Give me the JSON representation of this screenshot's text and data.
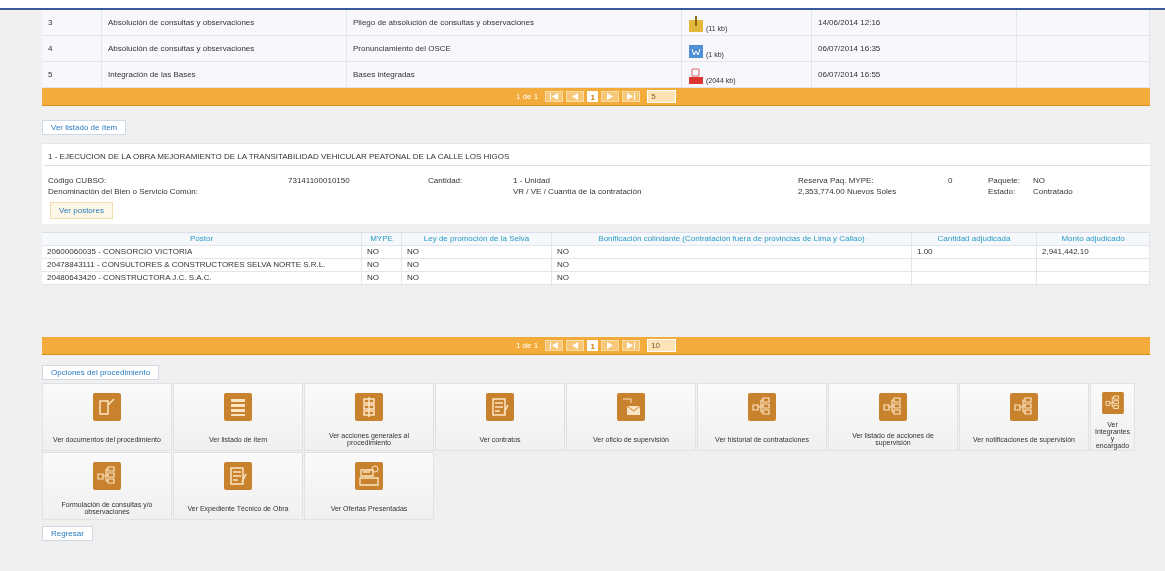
{
  "documents": {
    "rows": [
      {
        "number": "3",
        "stage": "Absolución de consultas y observaciones",
        "document": "Pliego de absolución de consultas y observaciones",
        "file": {
          "kind": "zip",
          "size": "(11 kb)"
        },
        "date": "14/06/2014 12:16"
      },
      {
        "number": "4",
        "stage": "Absolución de consultas y observaciones",
        "document": "Pronunciamiento del OSCE",
        "file": {
          "kind": "word",
          "size": "(1 kb)"
        },
        "date": "06/07/2014 16:35"
      },
      {
        "number": "5",
        "stage": "Integración de las Bases",
        "document": "Bases integradas",
        "file": {
          "kind": "pdf",
          "size": "(2044 kb)"
        },
        "date": "06/07/2014 16:55"
      }
    ],
    "pager": {
      "label": "1 de 1",
      "pages": [
        {
          "label": "1",
          "selected": true
        }
      ],
      "page_size": "5"
    }
  },
  "items_tab": "Ver listado de ítem",
  "item": {
    "title": "1 - EJECUCION DE LA OBRA MEJORAMIENTO DE LA TRANSITABILIDAD VEHICULAR PEATONAL DE LA CALLE LOS HIGOS",
    "fields": [
      {
        "label": "Código CUBSO:",
        "value": "73141100010150"
      },
      {
        "label": "Cantidad:",
        "value": "1 - Unidad"
      },
      {
        "label": "Reserva Paq. MYPE:",
        "value": "0"
      },
      {
        "label": "Paquete:",
        "value": "NO"
      },
      {
        "label": "Denominación del Bien o Servicio Común:"
      },
      {
        "value": "VR / VE / Cuantía de la contratación"
      },
      {
        "value": "2,353,774.00 Nuevos Soles"
      },
      {
        "label": "Estado:",
        "value": "Contratado"
      }
    ],
    "button": "Ver postores"
  },
  "bidders": {
    "columns": [
      "Postor",
      "MYPE",
      "Ley de promoción de la Selva",
      "Bonificación colindante (Contratación fuera de provincias de Lima y Callao)",
      "Cantidad adjudicada",
      "Monto adjudicado"
    ],
    "rows": [
      [
        "20600060035 - CONSORCIO VICTORIA",
        "NO",
        "NO",
        "NO",
        "1.00",
        "2,941,442.10"
      ],
      [
        "20478843111 - CONSULTORES & CONSTRUCTORES SELVA NORTE S.R.L.",
        "NO",
        "NO",
        "NO",
        "",
        ""
      ],
      [
        "20480643420 - CONSTRUCTORA J.C. S.A.C.",
        "NO",
        "NO",
        "NO",
        "",
        ""
      ]
    ],
    "pager": {
      "label": "1 de 1",
      "pages": [
        {
          "label": "1",
          "selected": true
        }
      ],
      "page_size": "10"
    }
  },
  "options": {
    "title": "Opciones del procedimiento",
    "tiles": [
      {
        "kind": "document",
        "label": "Ver documentos del procedimiento"
      },
      {
        "kind": "list",
        "label": "Ver listado de ítem"
      },
      {
        "kind": "tree",
        "label": "Ver acciones generales al procedimiento"
      },
      {
        "kind": "notes",
        "label": "Ver contratos"
      },
      {
        "kind": "mail",
        "label": "Ver oficio de supervisión"
      },
      {
        "kind": "flow",
        "label": "Ver historial de contrataciones"
      },
      {
        "kind": "flow",
        "label": "Ver listado de acciones de supervisión"
      },
      {
        "kind": "flow",
        "label": "Ver notificaciones de supervisión"
      },
      {
        "kind": "flow",
        "label": "Ver Integrantes y encargado"
      },
      {
        "kind": "flow",
        "label": "Formulación de consultas y/o observaciones"
      },
      {
        "kind": "notes",
        "label": "Ver Expediente Técnico de Obra"
      },
      {
        "kind": "cards",
        "label": "Ver Ofertas Presentadas"
      }
    ]
  },
  "back": "Regresar"
}
